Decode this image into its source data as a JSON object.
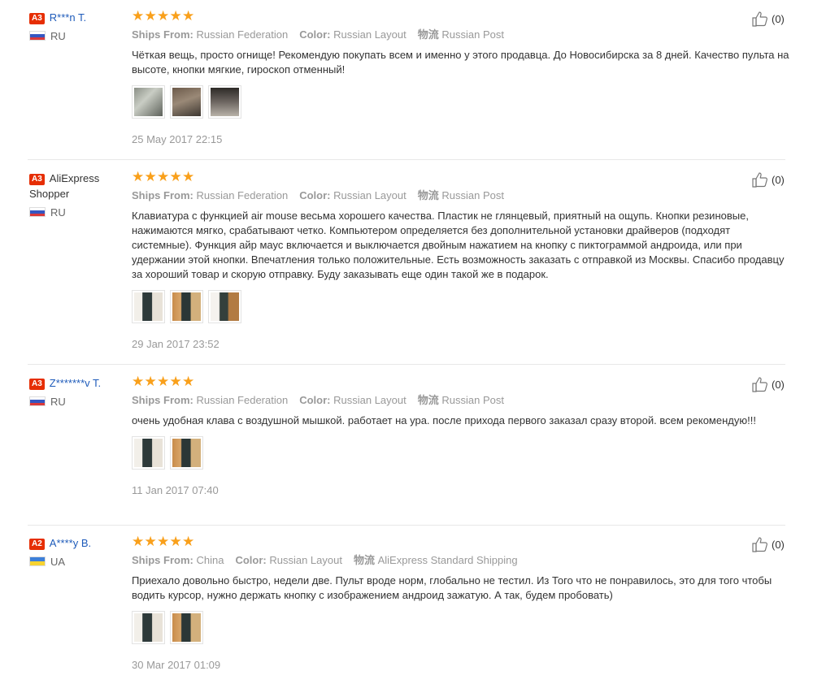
{
  "labels": {
    "ships_from": "Ships From:",
    "color": "Color:",
    "logistics": "物流"
  },
  "colors": {
    "star": "#f9a01b",
    "badge": "#e62e04",
    "link": "#1e5bba"
  },
  "reviews": [
    {
      "level": "A3",
      "name": "R***n T.",
      "name_is_link": true,
      "country": "RU",
      "rating": 5,
      "ships_from": "Russian Federation",
      "color": "Russian Layout",
      "logistics": "Russian Post",
      "text": "Чёткая вещь, просто огнище! Рекомендую покупать всем и именно у этого продавца. До Новосибирска за 8 дней. Качество пульта на высоте, кнопки мягкие, гироскоп отменный!",
      "photo_count": 3,
      "date": "25 May 2017 22:15",
      "helpful": "(0)"
    },
    {
      "level": "A3",
      "name": "AliExpress Shopper",
      "name_is_link": false,
      "country": "RU",
      "rating": 5,
      "ships_from": "Russian Federation",
      "color": "Russian Layout",
      "logistics": "Russian Post",
      "text": "Клавиатура с функцией air mouse весьма хорошего качества. Пластик не глянцевый, приятный на ощупь. Кнопки резиновые, нажимаются мягко, срабатывают четко. Компьютером определяется без дополнительной установки драйверов (подходят системные). Функция айр маус включается и выключается двойным нажатием на кнопку с пиктограммой андроида, или при удержании этой кнопки. Впечатления только положительные. Есть возможность заказать с отправкой из Москвы. Спасибо продавцу за хороший товар и скорую отправку. Буду заказывать еще один такой же в подарок.",
      "photo_count": 3,
      "date": "29 Jan 2017 23:52",
      "helpful": "(0)"
    },
    {
      "level": "A3",
      "name": "Z*******v T.",
      "name_is_link": true,
      "country": "RU",
      "rating": 5,
      "ships_from": "Russian Federation",
      "color": "Russian Layout",
      "logistics": "Russian Post",
      "text": "очень удобная клава с воздушной мышкой. работает на ура. после прихода первого заказал сразу второй. всем рекомендую!!!",
      "photo_count": 2,
      "date": "11 Jan 2017 07:40",
      "helpful": "(0)"
    },
    {
      "level": "A2",
      "name": "A****y B.",
      "name_is_link": true,
      "country": "UA",
      "rating": 5,
      "ships_from": "China",
      "color": "Russian Layout",
      "logistics": "AliExpress Standard Shipping",
      "text": "Приехало довольно быстро, недели две. Пульт вроде норм, глобально не тестил. Из Того что не понравилось, это для того чтобы водить курсор, нужно держать кнопку с изображением андроид зажатую. А так, будем пробовать)",
      "photo_count": 2,
      "date": "30 Mar 2017 01:09",
      "helpful": "(0)"
    }
  ]
}
